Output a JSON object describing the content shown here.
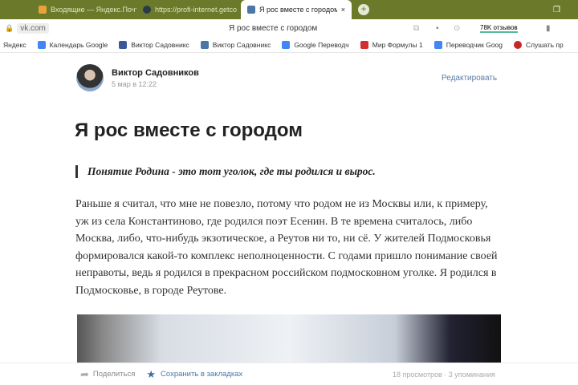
{
  "browser": {
    "tabs": [
      {
        "label": "Входящие — Яндекс.Почт",
        "color": "#e8a33a"
      },
      {
        "label": "https://profi-internet.getco",
        "color": "#2b3a4a"
      },
      {
        "label": "Я рос вместе с городом",
        "color": "#4a76a8",
        "active": true
      }
    ],
    "address": "vk.com",
    "page_title": "Я рос вместе с городом",
    "reviews": "78K отзывов",
    "bookmarks": [
      {
        "label": "Яндекс"
      },
      {
        "label": "Календарь Google",
        "color": "#4285f4"
      },
      {
        "label": "Виктор Садовникс",
        "color": "#3b5998"
      },
      {
        "label": "Виктор Садовникс",
        "color": "#4a76a8"
      },
      {
        "label": "Google Переводч",
        "color": "#4285f4"
      },
      {
        "label": "Мир Формулы 1",
        "color": "#d32f2f"
      },
      {
        "label": "Переводчик Goog",
        "color": "#4285f4"
      },
      {
        "label": "Слушать пр",
        "color": "#c62828"
      }
    ]
  },
  "post": {
    "author": "Виктор Садовников",
    "date": "5 мар в 12:22",
    "edit": "Редактировать",
    "title": "Я рос вместе с городом",
    "quote": "Понятие Родина - это тот уголок, где ты родился и вырос.",
    "paragraph": "Раньше я считал, что мне не повезло, потому что родом не из Москвы или, к примеру, уж из села Константиново, где родился поэт Есенин. В те времена считалось, либо Москва, либо, что-нибудь экзотическое, а Реутов ни то, ни сё. У жителей Подмосковья формировался какой-то комплекс неполноценности. С годами пришло понимание своей неправоты, ведь я родился в прекрасном российском подмосковном уголке. Я родился в Подмосковье, в городе Реутове."
  },
  "footer": {
    "share": "Поделиться",
    "bookmark": "Сохранить в закладках",
    "stats": "18 просмотров · 3 упоминания"
  }
}
